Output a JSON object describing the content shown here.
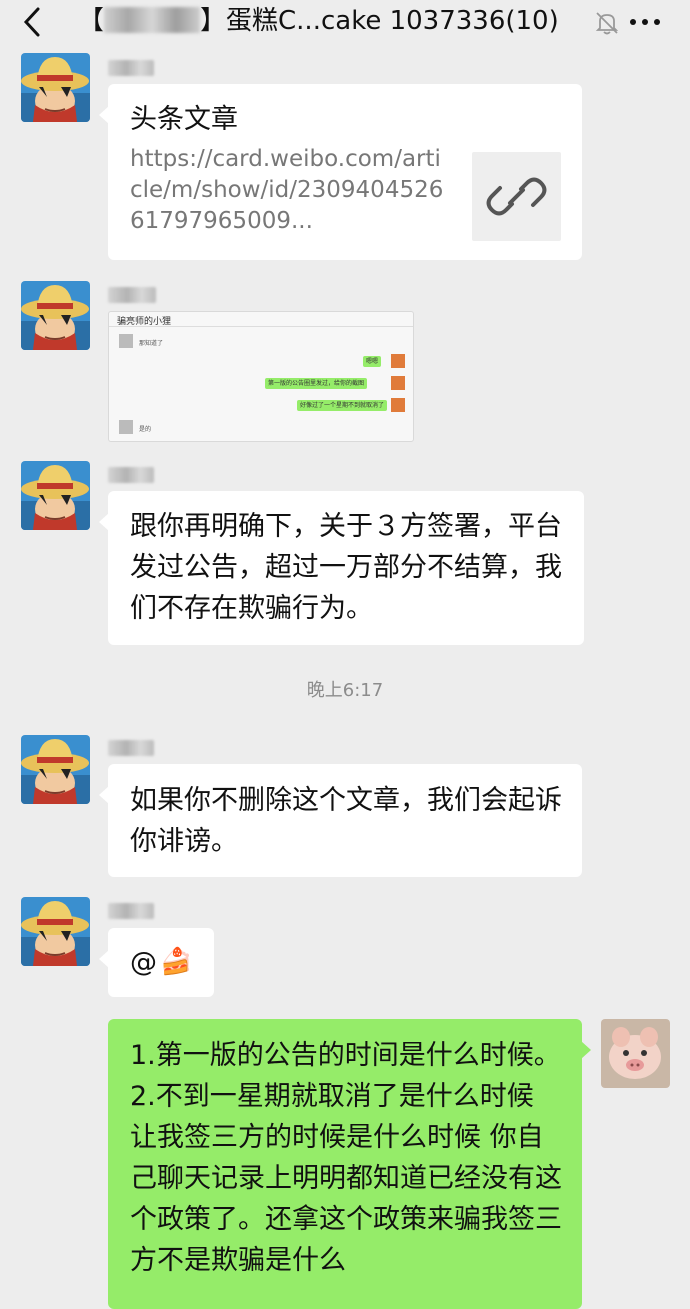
{
  "header": {
    "title_prefix": "【",
    "title_suffix": "】蛋糕C...cake  1037336(10)",
    "icons": [
      "back-arrow-icon",
      "mute-bell-icon",
      "more-icon"
    ]
  },
  "messages": {
    "m1": {
      "title": "头条文章",
      "url": "https://card.weibo.com/article/m/show/id/2309404526617979650​09...",
      "thumb_icon": "link-icon"
    },
    "m2": {
      "shot_title": "骗亮师的小狸",
      "shot_line1": "那知道了",
      "shot_green1": "嗯嗯",
      "shot_green2": "第一版的公告圈里发过，给你的截图",
      "shot_green3": "好像过了一个星期不到就取消了",
      "shot_line2": "是的"
    },
    "m3": {
      "text": "跟你再明确下，关于３方签署，平台发过公告，超过一万部分不结算，我们不存在欺骗行为。"
    },
    "timestamp": "晚上6:17",
    "m4": {
      "text": "如果你不删除这个文章，我们会起诉你诽谤。"
    },
    "m5": {
      "text": "@",
      "emoji": "🍰"
    },
    "m6": {
      "text": "1.第一版的公告的时间是什么时候。2.不到一星期就取消了是什么时候 让我签三方的时候是什么时候 你自己聊天记录上明明都知道已经没有这个政策了。还拿这个政策来骗我签三方不是欺骗是什么"
    }
  },
  "colors": {
    "background": "#ededed",
    "bubble_white": "#ffffff",
    "bubble_green": "#95ec69"
  }
}
